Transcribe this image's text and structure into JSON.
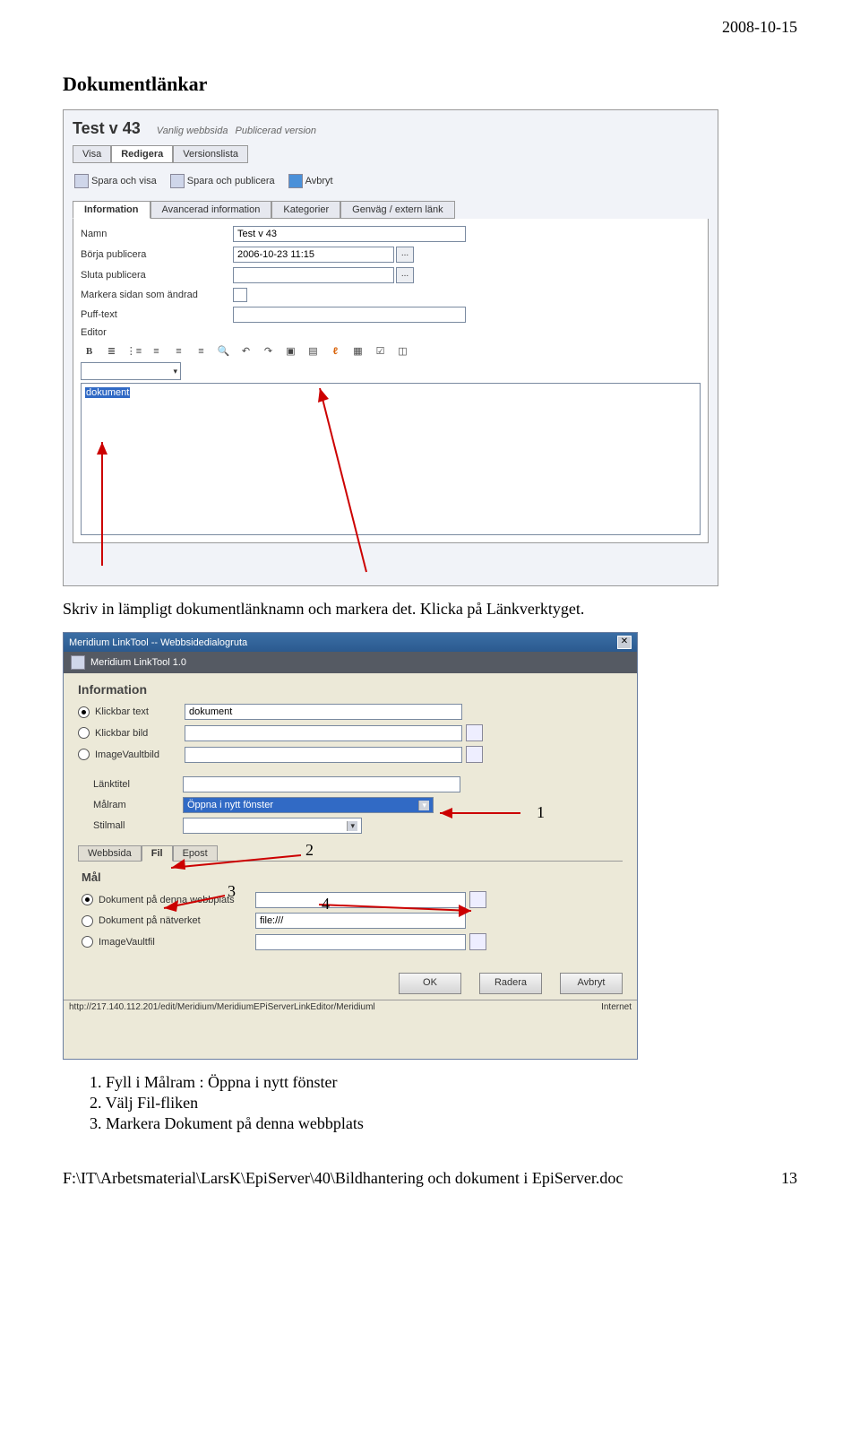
{
  "page": {
    "header_date": "2008-10-15",
    "section_title": "Dokumentlänkar",
    "body_text": "Skriv in lämpligt dokumentlänknamn och markera det. Klicka på Länkverktyget.",
    "instructions": {
      "i1": "Fyll i Målram : Öppna i nytt fönster",
      "i2": "Välj Fil-fliken",
      "i3": "Markera Dokument på denna webbplats"
    },
    "footer_path": "F:\\IT\\Arbetsmaterial\\LarsK\\EpiServer\\40\\Bildhantering och dokument i EpiServer.doc",
    "footer_page": "13"
  },
  "screenshot1": {
    "title": "Test v 43",
    "subtitle_type": "Vanlig webbsida",
    "subtitle_status": "Publicerad version",
    "main_tabs": {
      "visa": "Visa",
      "redigera": "Redigera",
      "versionslista": "Versionslista"
    },
    "actions": {
      "save_view": "Spara och visa",
      "save_publish": "Spara och publicera",
      "cancel": "Avbryt"
    },
    "info_tabs": {
      "information": "Information",
      "advanced": "Avancerad information",
      "categories": "Kategorier",
      "shortcut": "Genväg / extern länk"
    },
    "fields": {
      "name_label": "Namn",
      "name_value": "Test v 43",
      "start_label": "Börja publicera",
      "start_value": "2006-10-23 11:15",
      "stop_label": "Sluta publicera",
      "mark_label": "Markera sidan som ändrad",
      "puff_label": "Puff-text",
      "editor_label": "Editor"
    },
    "editor_selected": "dokument"
  },
  "screenshot2": {
    "titlebar": "Meridium LinkTool -- Webbsidedialogruta",
    "subheader": "Meridium LinkTool 1.0",
    "section_info": "Information",
    "radios": {
      "klickbar_text": "Klickbar text",
      "klickbar_text_value": "dokument",
      "klickbar_bild": "Klickbar bild",
      "imagevault": "ImageVaultbild"
    },
    "fields": {
      "linktitel": "Länktitel",
      "malram": "Målram",
      "malram_value": "Öppna i nytt fönster",
      "stilmall": "Stilmall"
    },
    "tabs": {
      "webbsida": "Webbsida",
      "fil": "Fil",
      "epost": "Epost"
    },
    "section_mal": "Mål",
    "target_radios": {
      "doc_site": "Dokument på denna webbplats",
      "doc_net": "Dokument på nätverket",
      "doc_net_value": "file:///",
      "iv_file": "ImageVaultfil"
    },
    "buttons": {
      "ok": "OK",
      "radera": "Radera",
      "avbryt": "Avbryt"
    },
    "status_left": "http://217.140.112.201/edit/Meridium/MeridiumEPiServerLinkEditor/Meridiuml",
    "status_right": "Internet"
  },
  "annotations": {
    "n1": "1",
    "n2": "2",
    "n3": "3",
    "n4": "4"
  }
}
